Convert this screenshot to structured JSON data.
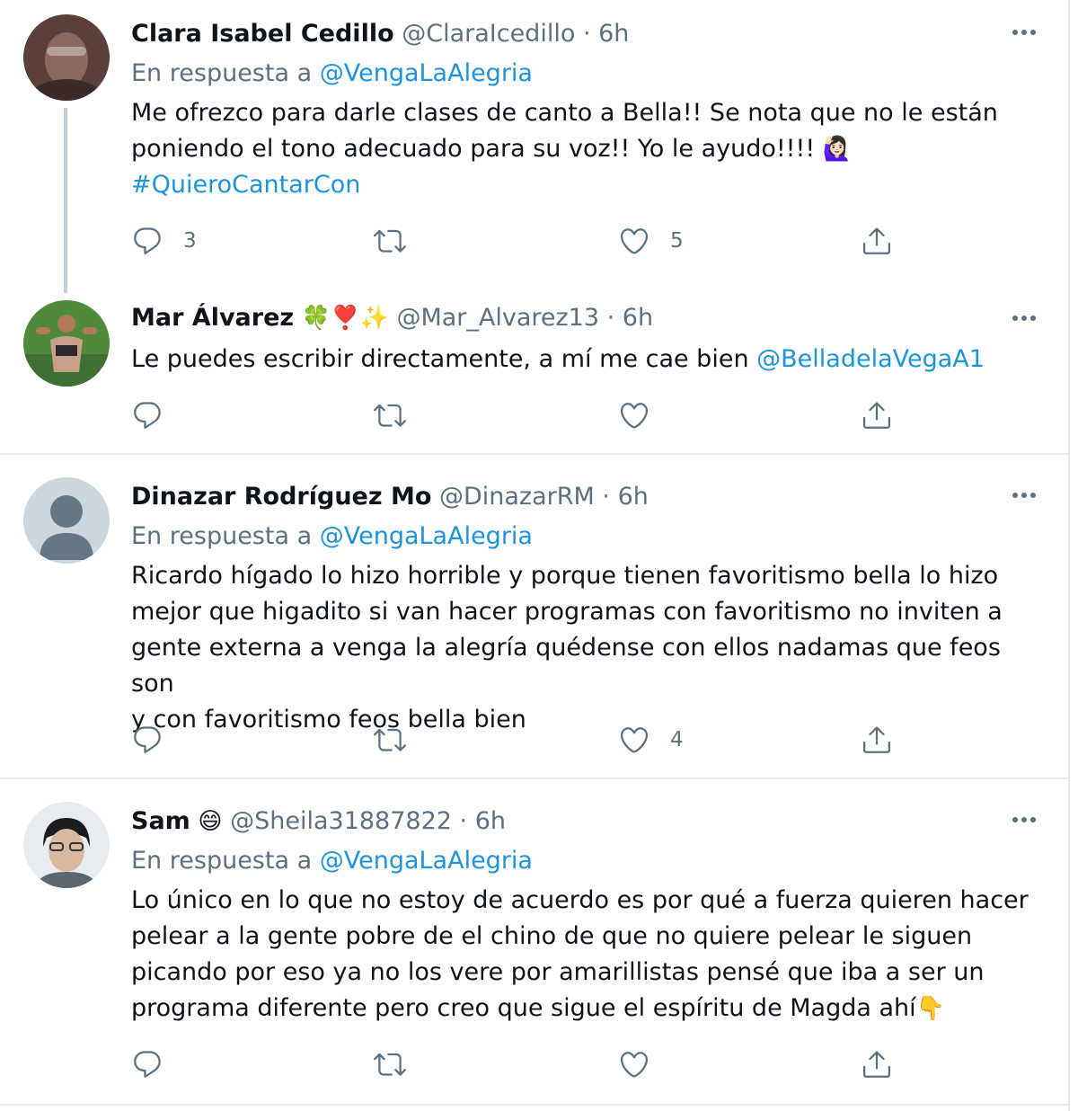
{
  "tweets": [
    {
      "name": "Clara Isabel Cedillo",
      "handle": "@ClaraIcedillo",
      "time": "6h",
      "reply_prefix": "En respuesta a",
      "reply_to": "@VengaLaAlegria",
      "text_line1": "Me ofrezco para darle clases de canto a Bella!! Se nota que no le están",
      "text_line2": "poniendo el tono adecuado para su voz!! Yo le ayudo!!!!",
      "text_emoji": "🙋🏻‍♀️",
      "hashtag": "#QuieroCantarCon",
      "replies": "3",
      "retweets": "",
      "likes": "5"
    },
    {
      "name": "Mar Álvarez",
      "name_emoji": "🍀❣️✨",
      "handle": "@Mar_Alvarez13",
      "time": "6h",
      "text": "Le puedes escribir directamente, a mí me cae bien",
      "mention": "@BelladelaVegaA1",
      "replies": "",
      "retweets": "",
      "likes": ""
    },
    {
      "name": "Dinazar Rodríguez Mo",
      "handle": "@DinazarRM",
      "time": "6h",
      "reply_prefix": "En respuesta a",
      "reply_to": "@VengaLaAlegria",
      "text_line1": "Ricardo hígado lo hizo horrible y porque tienen favoritismo bella lo hizo",
      "text_line2": "mejor que higadito si van hacer programas con favoritismo no inviten a",
      "text_line3": "gente externa a venga la alegría quédense con ellos nadamas que feos son",
      "text_line4": "y con favoritismo feos bella bien",
      "replies": "",
      "retweets": "",
      "likes": "4"
    },
    {
      "name": "Sam",
      "name_emoji": "😄",
      "handle": "@Sheila31887822",
      "time": "6h",
      "reply_prefix": "En respuesta a",
      "reply_to": "@VengaLaAlegria",
      "text_line1": "Lo único en lo que no estoy de acuerdo es por qué a fuerza quieren hacer",
      "text_line2": "pelear a la gente pobre de el chino de que no quiere pelear le siguen",
      "text_line3": "picando por eso ya no los vere por amarillistas pensé que iba a ser un",
      "text_line4": "programa diferente pero creo que sigue el espíritu de Magda ahí",
      "text_emoji": "👇",
      "replies": "",
      "retweets": "",
      "likes": ""
    }
  ],
  "separator": " · ",
  "icons": {
    "reply": "reply-icon",
    "retweet": "retweet-icon",
    "like": "heart-icon",
    "share": "share-icon",
    "more": "more-icon"
  },
  "colors": {
    "link": "#1b95e0",
    "secondary_text": "#5b7083",
    "text": "#0f1419",
    "divider": "#e6ecf0"
  }
}
